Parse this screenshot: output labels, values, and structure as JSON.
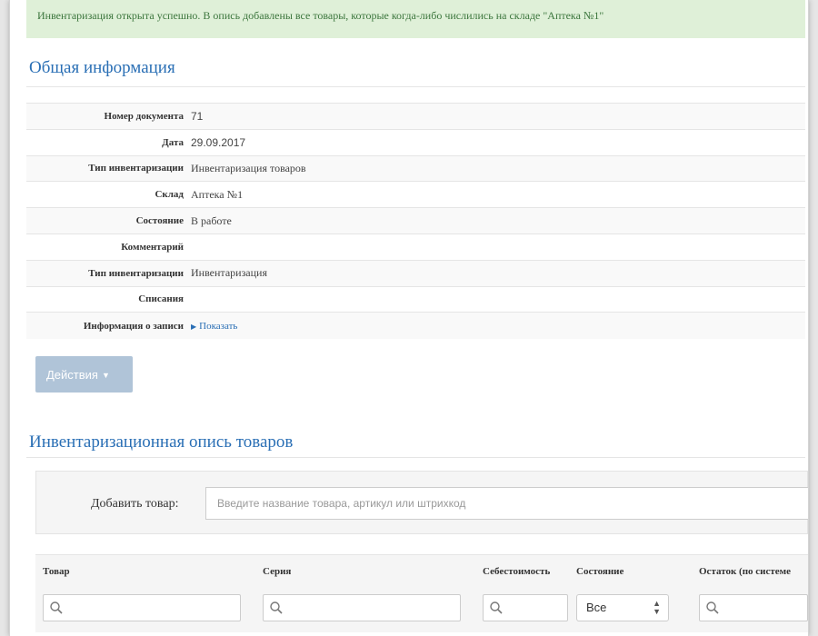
{
  "alert": {
    "text": "Инвентаризация открыта успешно. В опись добавлены все товары, которые когда-либо числились на складе \"Аптека №1\""
  },
  "general": {
    "title": "Общая информация",
    "rows": [
      {
        "label": "Номер документа",
        "value": "71"
      },
      {
        "label": "Дата",
        "value": "29.09.2017"
      },
      {
        "label": "Тип инвентаризации",
        "value": "Инвентаризация товаров"
      },
      {
        "label": "Склад",
        "value": "Аптека №1"
      },
      {
        "label": "Состояние",
        "value": "В работе"
      },
      {
        "label": "Комментарий",
        "value": ""
      },
      {
        "label": "Тип инвентаризации",
        "value": "Инвентаризация"
      },
      {
        "label": "Списания",
        "value": ""
      },
      {
        "label": "Информация о записи",
        "value": "Показать"
      }
    ]
  },
  "actions": {
    "label": "Действия"
  },
  "inventory": {
    "title": "Инвентаризационная опись товаров",
    "add_label": "Добавить товар:",
    "add_placeholder": "Введите название товара, артикул или штрихкод",
    "columns": [
      "Товар",
      "Серия",
      "Себестоимость",
      "Состояние",
      "Остаток (по системе"
    ],
    "state_filter": "Все"
  },
  "icons": {
    "search": "search-icon",
    "expand": "triangle-right-icon",
    "caret": "caret-down-icon"
  },
  "colors": {
    "link": "#2a6fb5",
    "alert_bg": "#dff0d8",
    "alert_text": "#3c763d",
    "button_bg": "#b0c4d8"
  }
}
